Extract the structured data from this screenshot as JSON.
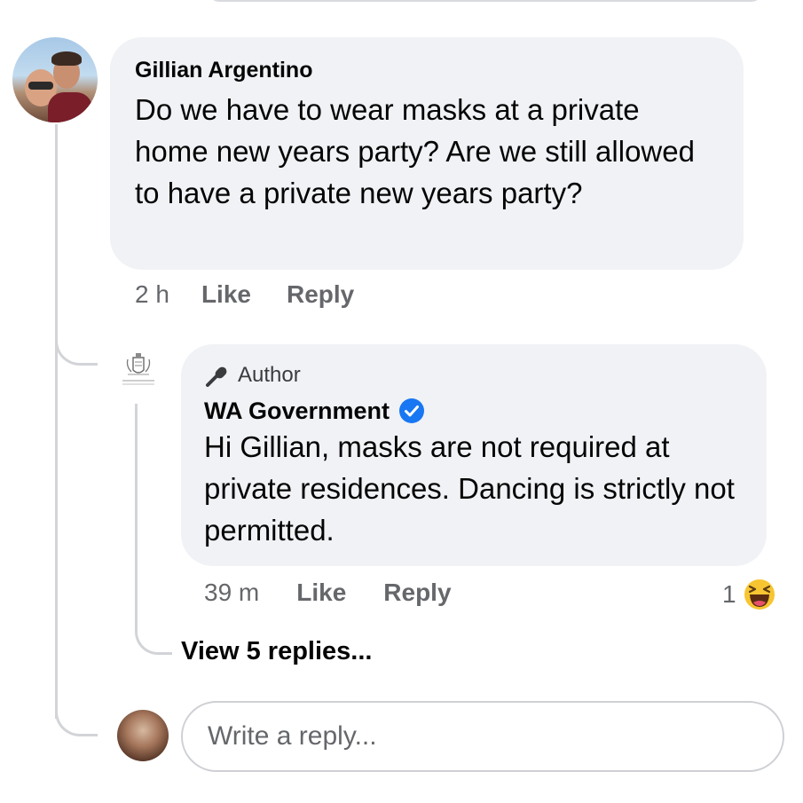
{
  "comment": {
    "author": "Gillian Argentino",
    "text": "Do we have to wear masks at a private home new years party?  Are we still allowed to have a private new years party?",
    "time": "2 h",
    "like_label": "Like",
    "reply_label": "Reply"
  },
  "reply": {
    "badge": "Author",
    "author": "WA Government",
    "verified": true,
    "text": "Hi Gillian, masks are not required at private residences. Dancing is strictly not permitted.",
    "time": "39 m",
    "like_label": "Like",
    "reply_label": "Reply",
    "reaction_count": "1",
    "reaction_icon": "haha-emoji-icon"
  },
  "view_replies": "View 5 replies...",
  "reply_box": {
    "placeholder": "Write a reply..."
  },
  "colors": {
    "bubble": "#f0f2f5",
    "meta_text": "#65676b",
    "verified_blue": "#1877f2",
    "haha_yellow": "#f7c531"
  }
}
